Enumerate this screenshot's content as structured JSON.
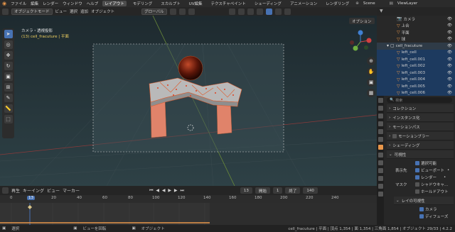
{
  "topbar": {
    "menus": [
      "ファイル",
      "編集",
      "レンダー",
      "ウィンドウ",
      "ヘルプ"
    ],
    "workspaces": [
      "レイアウト",
      "モデリング",
      "スカルプト",
      "UV編集",
      "テクスチャペイント",
      "シェーディング",
      "アニメーション",
      "レンダリング"
    ],
    "active_workspace": "レイアウト",
    "scene": "Scene",
    "view_layer": "ViewLayer"
  },
  "viewport_header": {
    "mode": "オブジェクトモード",
    "menus": [
      "ビュー",
      "選択",
      "追加",
      "オブジェクト"
    ],
    "transform": "グローバル",
    "options": "オプション"
  },
  "viewport": {
    "camera_title": "カメラ・透視投影",
    "camera_subtitle": "(13) cell_fracuture | 平面"
  },
  "timeline": {
    "menus": [
      "再生",
      "キーイング",
      "ビュー",
      "マーカー"
    ],
    "current_frame": "13",
    "start_label": "開始",
    "start": "1",
    "end_label": "終了",
    "end": "140",
    "ruler": [
      "0",
      "20",
      "40",
      "60",
      "80",
      "100",
      "120",
      "140",
      "160",
      "180",
      "200",
      "220",
      "240"
    ],
    "frame_marker": "13"
  },
  "status": {
    "select": "選択",
    "rotate": "ビューを回転",
    "object": "オブジェクト",
    "stats": "cell_fracuture | 平面 | 頂点 1,354 | 面 1,354 | 三角面 1,854 | オブジェクト 29/33 | 4.2.2"
  },
  "outliner": {
    "rows": [
      {
        "label": "カメラ",
        "selected": false
      },
      {
        "label": "上合",
        "selected": false
      },
      {
        "label": "平面",
        "selected": false
      },
      {
        "label": "球",
        "selected": false
      },
      {
        "label": "cell_fracuture",
        "selected": false
      },
      {
        "label": "left_cell",
        "selected": true
      },
      {
        "label": "left_cell.001",
        "selected": true
      },
      {
        "label": "left_cell.002",
        "selected": true
      },
      {
        "label": "left_cell.003",
        "selected": true
      },
      {
        "label": "left_cell.004",
        "selected": true
      },
      {
        "label": "left_cell.005",
        "selected": true
      },
      {
        "label": "left_cell.006",
        "selected": true
      }
    ]
  },
  "properties": {
    "search_placeholder": "検索",
    "sections": [
      "コレクション",
      "インスタンス化",
      "モーションパス",
      "モーションブラー",
      "シェーディング",
      "可視性"
    ],
    "visibility": {
      "selectable": "選択可能",
      "show_in": "表示先",
      "viewport": "ビューポート",
      "render": "レンダー",
      "mask": "マスク",
      "shadow_catcher": "シャドウキャ...",
      "holdout": "ホールドアウト",
      "ray_visibility": "レイの可視性",
      "camera": "カメラ",
      "diffuse": "ディフューズ"
    }
  },
  "colors": {
    "accent": "#4772b3",
    "object": "#e8964a",
    "selected_row": "#1d3a5f"
  }
}
